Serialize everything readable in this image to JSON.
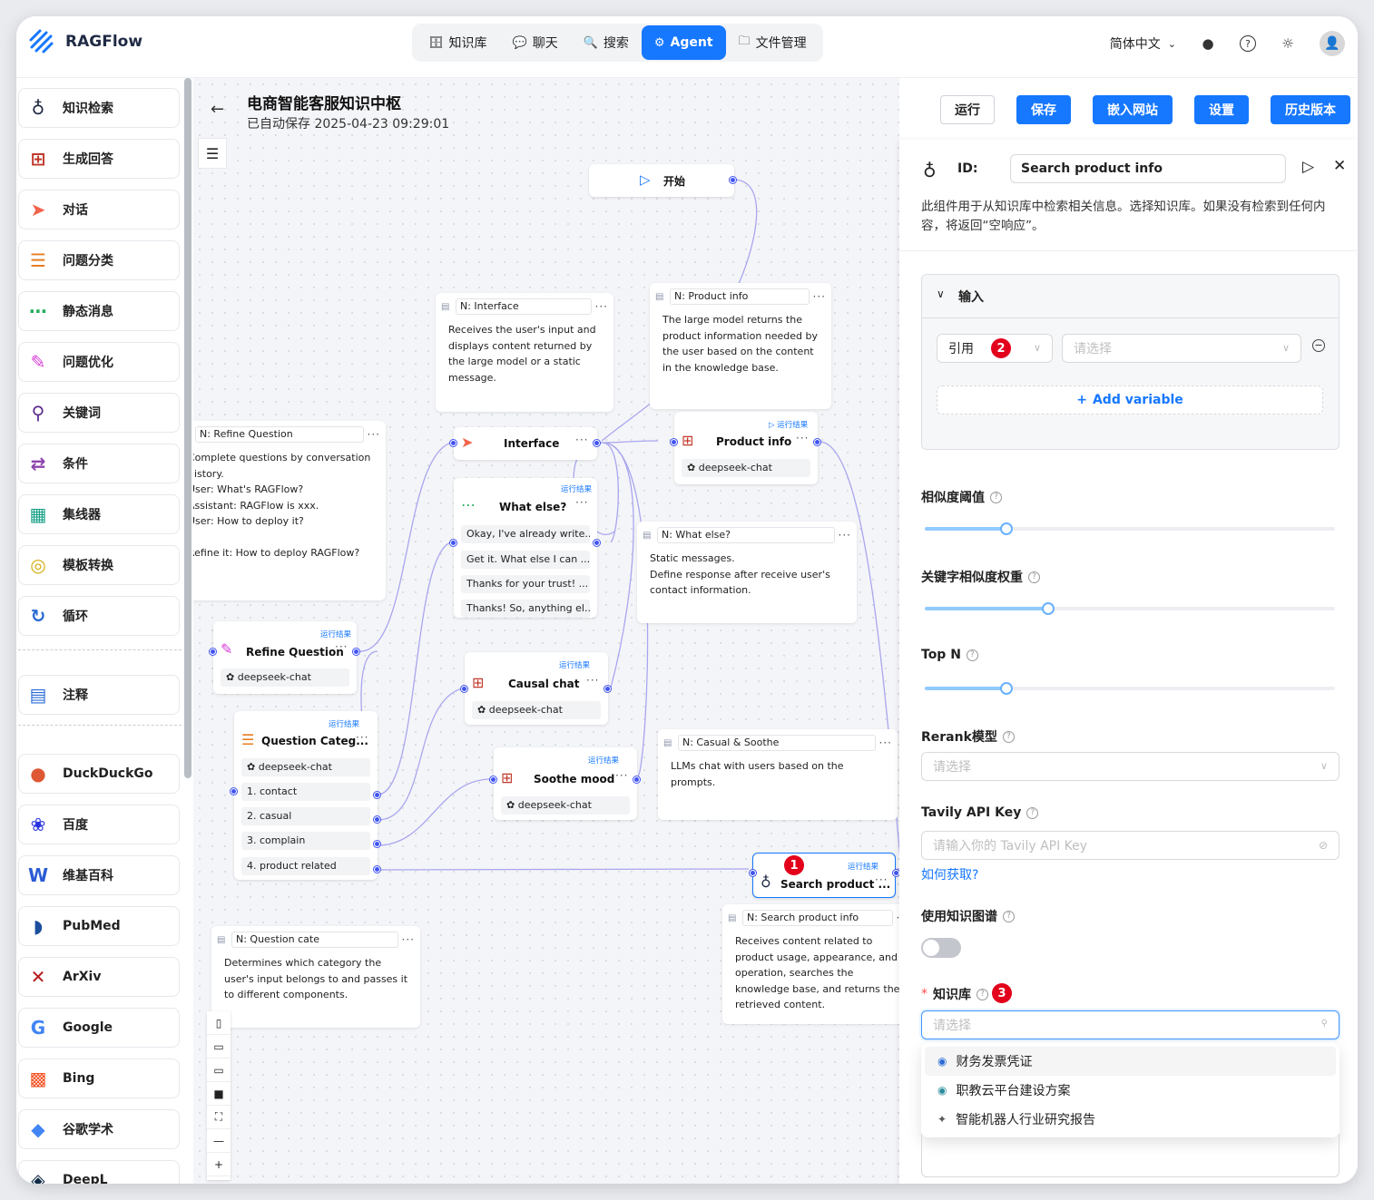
{
  "app": {
    "name": "RAGFlow"
  },
  "nav": {
    "tabs": [
      {
        "label": "知识库",
        "icon": "database-icon",
        "glyph": "🗄"
      },
      {
        "label": "聊天",
        "icon": "chat-icon",
        "glyph": "💬"
      },
      {
        "label": "搜索",
        "icon": "search-icon",
        "glyph": "🔍"
      },
      {
        "label": "Agent",
        "icon": "agent-icon",
        "glyph": "⚙"
      },
      {
        "label": "文件管理",
        "icon": "folder-icon",
        "glyph": "🗀"
      }
    ],
    "active_tab": "Agent",
    "language": "简体中文",
    "accent": "#1677ff"
  },
  "sidebar": {
    "components": [
      {
        "label": "知识检索",
        "icon": "retrieval-icon",
        "glyph": "♁",
        "color": "#1f2a44"
      },
      {
        "label": "生成回答",
        "icon": "generate-icon",
        "glyph": "⊞",
        "color": "#c0392b"
      },
      {
        "label": "对话",
        "icon": "send-icon",
        "glyph": "➤",
        "color": "#f0644b"
      },
      {
        "label": "问题分类",
        "icon": "categorize-icon",
        "glyph": "☰",
        "color": "#e67e22"
      },
      {
        "label": "静态消息",
        "icon": "message-icon",
        "glyph": "⋯",
        "color": "#27ae60"
      },
      {
        "label": "问题优化",
        "icon": "rewrite-icon",
        "glyph": "✎",
        "color": "#d63ad6"
      },
      {
        "label": "关键词",
        "icon": "keyword-icon",
        "glyph": "⚲",
        "color": "#5b2d8e"
      },
      {
        "label": "条件",
        "icon": "switch-icon",
        "glyph": "⇄",
        "color": "#8e44ad"
      },
      {
        "label": "集线器",
        "icon": "concentrator-icon",
        "glyph": "▦",
        "color": "#16a085"
      },
      {
        "label": "模板转换",
        "icon": "template-icon",
        "glyph": "◎",
        "color": "#d4ac0d"
      },
      {
        "label": "循环",
        "icon": "loop-icon",
        "glyph": "↻",
        "color": "#2b6cd4"
      }
    ],
    "notes": [
      {
        "label": "注释",
        "icon": "note-icon",
        "glyph": "▤",
        "color": "#2b6cd4"
      }
    ],
    "tools": [
      {
        "label": "DuckDuckGo",
        "icon": "duckduckgo-icon",
        "glyph": "●",
        "color": "#de5833"
      },
      {
        "label": "百度",
        "icon": "baidu-icon",
        "glyph": "❀",
        "color": "#2932e1"
      },
      {
        "label": "维基百科",
        "icon": "wikipedia-icon",
        "glyph": "W",
        "color": "#2b5cd4"
      },
      {
        "label": "PubMed",
        "icon": "pubmed-icon",
        "glyph": "◗",
        "color": "#1d4e9e"
      },
      {
        "label": "ArXiv",
        "icon": "arxiv-icon",
        "glyph": "✕",
        "color": "#b31b1b"
      },
      {
        "label": "Google",
        "icon": "google-icon",
        "glyph": "G",
        "color": "#4285f4"
      },
      {
        "label": "Bing",
        "icon": "bing-icon",
        "glyph": "▩",
        "color": "#f25022"
      },
      {
        "label": "谷歌学术",
        "icon": "scholar-icon",
        "glyph": "◆",
        "color": "#4285f4"
      },
      {
        "label": "DeepL",
        "icon": "deepl-icon",
        "glyph": "◈",
        "color": "#0f2b46"
      }
    ]
  },
  "header": {
    "title": "电商智能客服知识中枢",
    "autosave": "已自动保存 2025-04-23 09:29:01",
    "buttons": {
      "run": "运行",
      "save": "保存",
      "embed": "嵌入网站",
      "settings": "设置",
      "history": "历史版本"
    }
  },
  "canvas": {
    "start": "开始",
    "run_result": "运行结果",
    "notes": {
      "interface": {
        "title": "N: Interface",
        "body": "Receives the user's input and displays content returned by the large model or a static message."
      },
      "product_info": {
        "title": "N: Product info",
        "body": "The large model returns the product information needed by the user based on the content in the knowledge base."
      },
      "refine": {
        "title": "N: Refine Question",
        "body": "Complete questions by conversation history.\nUser: What's RAGFlow?\nAssistant: RAGFlow is xxx.\nUser: How to deploy it?\n\nRefine it: How to deploy RAGFlow?"
      },
      "what_else": {
        "title": "N: What else?",
        "body": "Static messages.\nDefine response after receive user's contact information."
      },
      "casual": {
        "title": "N: Casual & Soothe",
        "body": "LLMs chat with users based on the prompts."
      },
      "question_cate": {
        "title": "N: Question cate",
        "body": "Determines which category the user's input belongs to and passes it to different components."
      },
      "search_info": {
        "title": "N: Search product info",
        "body": "Receives content related to product usage, appearance, and operation, searches the knowledge base, and returns the retrieved content."
      }
    },
    "nodes": {
      "interface": {
        "title": "Interface"
      },
      "product_info": {
        "title": "Product info",
        "model": "deepseek-chat"
      },
      "what_else": {
        "title": "What else?",
        "messages": [
          "Okay, I've already write...",
          "Get it. What else I can ...",
          "Thanks for your trust! ...",
          "Thanks! So, anything el..."
        ]
      },
      "refine": {
        "title": "Refine Question",
        "model": "deepseek-chat"
      },
      "causal": {
        "title": "Causal chat",
        "model": "deepseek-chat"
      },
      "question_categ": {
        "title": "Question Categ...",
        "model": "deepseek-chat",
        "categories": [
          "1. contact",
          "2. casual",
          "3. complain",
          "4. product related"
        ]
      },
      "soothe": {
        "title": "Soothe mood",
        "model": "deepseek-chat"
      },
      "search": {
        "title": "Search product ..."
      }
    },
    "badges": [
      "1",
      "2",
      "3"
    ]
  },
  "panel": {
    "id_label": "ID:",
    "id_value": "Search product info",
    "description": "此组件用于从知识库中检索相关信息。选择知识库。如果没有检索到任何内容，将返回“空响应”。",
    "input_section": "输入",
    "ref_label": "引用",
    "ref_placeholder": "请选择",
    "add_variable": "Add variable",
    "similarity_label": "相似度阈值",
    "similarity_value": 0.2,
    "keyword_weight_label": "关键字相似度权重",
    "keyword_weight_value": 0.3,
    "topn_label": "Top N",
    "topn_value": 8,
    "rerank_label": "Rerank模型",
    "rerank_placeholder": "请选择",
    "tavily_label": "Tavily API Key",
    "tavily_placeholder": "请输入你的 Tavily API Key",
    "tavily_link": "如何获取?",
    "kg_label": "使用知识图谱",
    "kg_enabled": false,
    "kb_label": "知识库",
    "kb_placeholder": "请选择",
    "kb_options": [
      {
        "label": "财务发票凭证",
        "icon": "kb-avatar-icon"
      },
      {
        "label": "职教云平台建设方案",
        "icon": "kb-avatar-icon"
      },
      {
        "label": "智能机器人行业研究报告",
        "icon": "kb-avatar-icon"
      }
    ]
  }
}
